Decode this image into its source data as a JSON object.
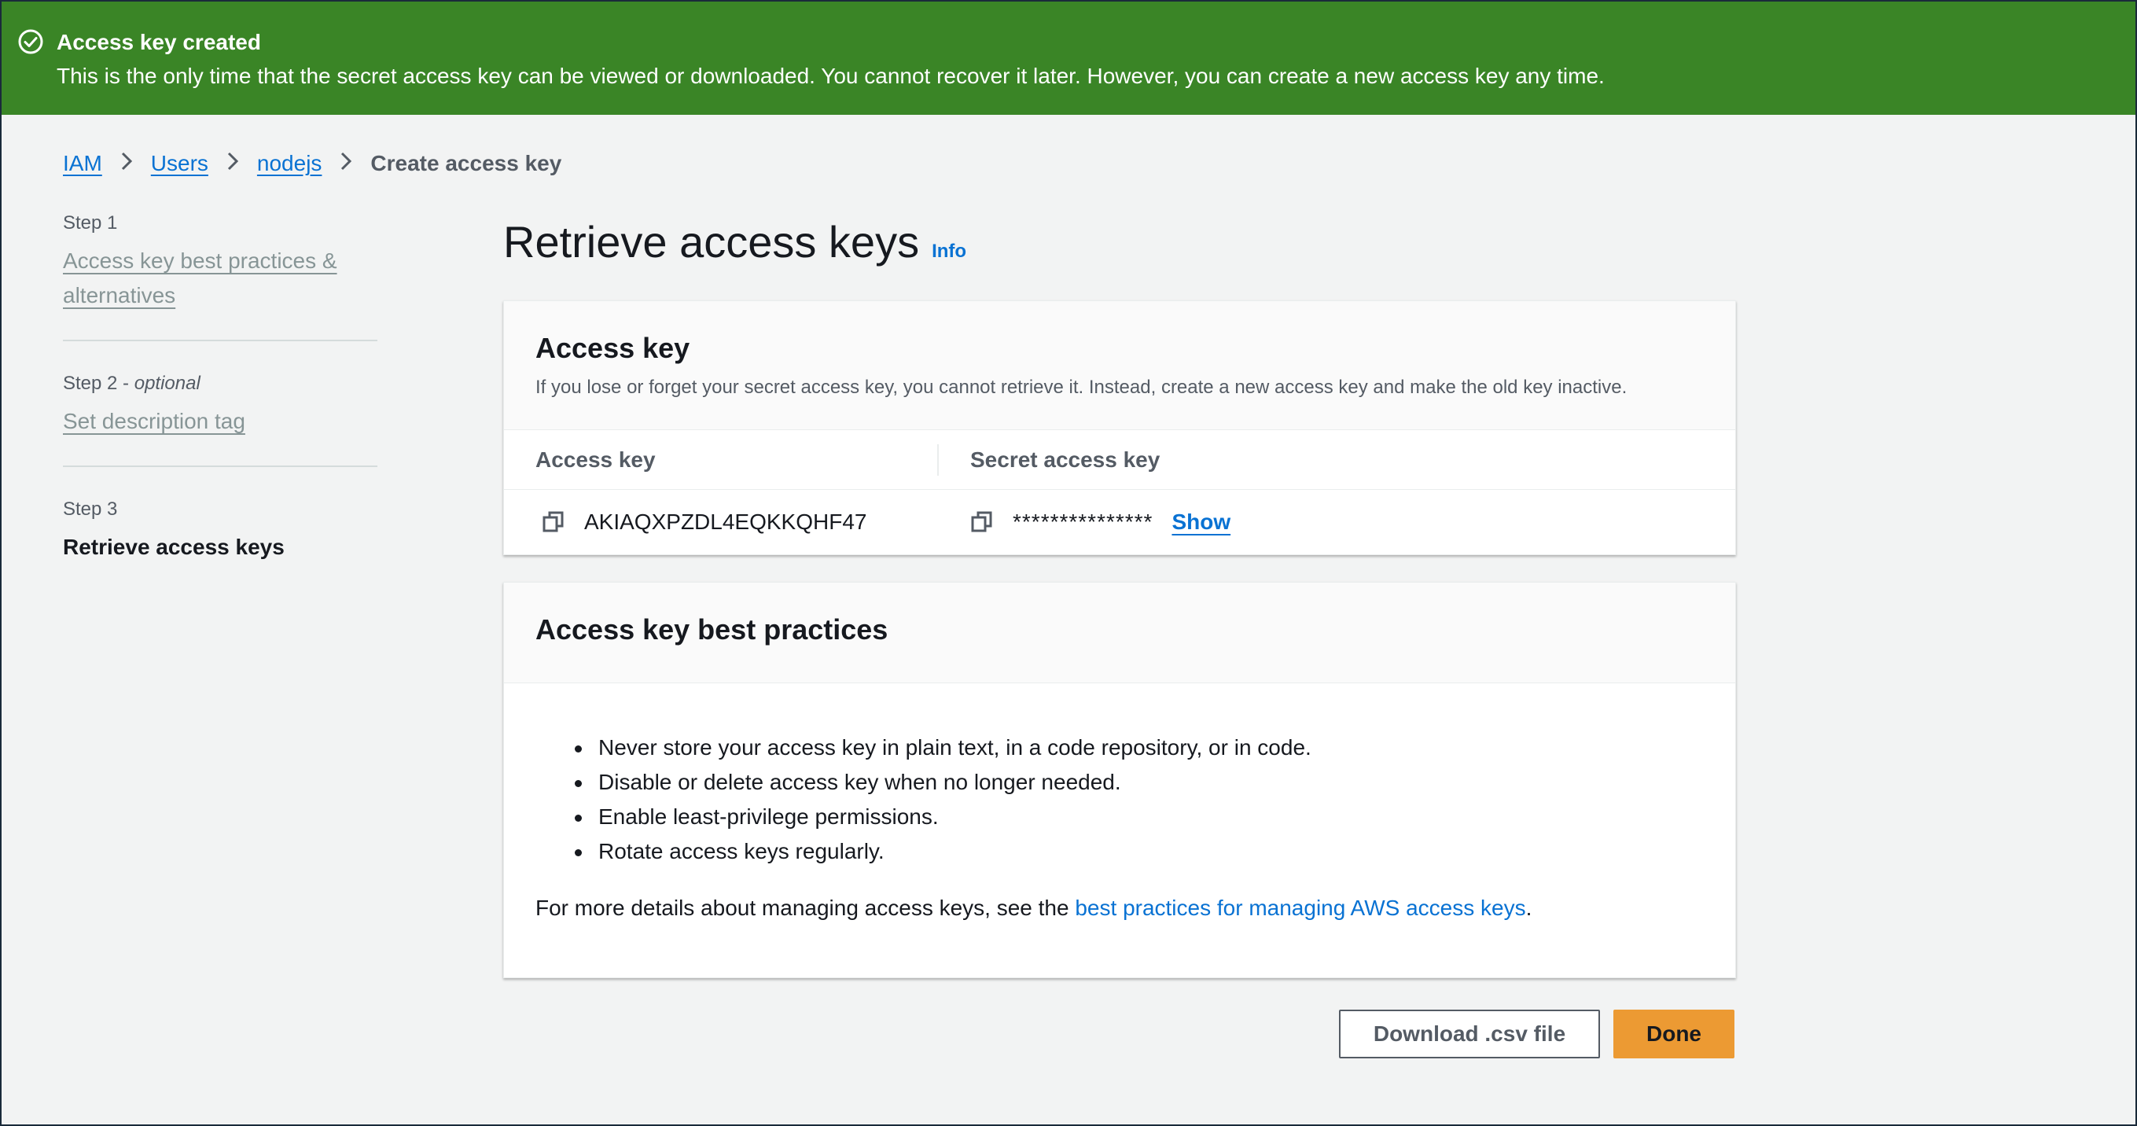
{
  "flash": {
    "title": "Access key created",
    "message": "This is the only time that the secret access key can be viewed or downloaded. You cannot recover it later. However, you can create a new access key any time.",
    "icon": "check-circle-icon",
    "color": "#3a8526"
  },
  "breadcrumb": {
    "items": [
      "IAM",
      "Users",
      "nodejs"
    ],
    "current": "Create access key"
  },
  "steps": [
    {
      "number": "Step 1",
      "optional": "",
      "label": "Access key best practices & alternatives"
    },
    {
      "number": "Step 2 - ",
      "optional": "optional",
      "label": "Set description tag"
    },
    {
      "number": "Step 3",
      "optional": "",
      "label": "Retrieve access keys"
    }
  ],
  "main": {
    "title": "Retrieve access keys",
    "info": "Info"
  },
  "access_key_panel": {
    "title": "Access key",
    "description": "If you lose or forget your secret access key, you cannot retrieve it. Instead, create a new access key and make the old key inactive.",
    "col_access_key": "Access key",
    "col_secret_key": "Secret access key",
    "access_key_value": "AKIAQXPZDL4EQKKQHF47",
    "secret_key_masked": "***************",
    "show_label": "Show"
  },
  "best_practices_panel": {
    "title": "Access key best practices",
    "items": [
      "Never store your access key in plain text, in a code repository, or in code.",
      "Disable or delete access key when no longer needed.",
      "Enable least-privilege permissions.",
      "Rotate access keys regularly."
    ],
    "more_prefix": "For more details about managing access keys, see the ",
    "more_link": "best practices for managing AWS access keys",
    "more_suffix": "."
  },
  "actions": {
    "download": "Download .csv file",
    "done": "Done"
  }
}
